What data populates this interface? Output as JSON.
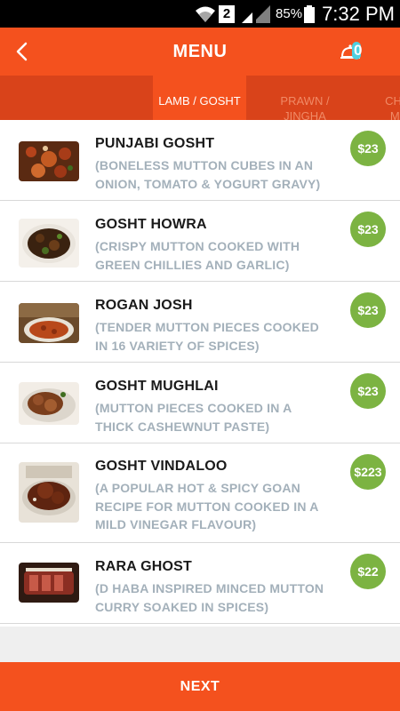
{
  "status_bar": {
    "sim_slot": "2",
    "battery": "85%",
    "time": "7:32 PM"
  },
  "header": {
    "title": "MENU",
    "cart_count": "0"
  },
  "tabs": [
    {
      "label": "LAMB / GOSHT",
      "active": true
    },
    {
      "label": "PRAWN / JINGHA",
      "active": false
    },
    {
      "label": "CHIC MU",
      "active": false
    }
  ],
  "items": [
    {
      "name": "PUNJABI GOSHT",
      "description": "(BONELESS MUTTON CUBES IN AN ONION, TOMATO & YOGURT GRAVY)",
      "price": "$23"
    },
    {
      "name": "GOSHT HOWRA",
      "description": "(CRISPY MUTTON COOKED WITH GREEN CHILLIES AND GARLIC)",
      "price": "$23"
    },
    {
      "name": "ROGAN JOSH",
      "description": "(TENDER MUTTON PIECES COOKED IN 16 VARIETY OF SPICES)",
      "price": "$23"
    },
    {
      "name": "GOSHT MUGHLAI",
      "description": "(MUTTON PIECES COOKED IN A THICK CASHEWNUT PASTE)",
      "price": "$23"
    },
    {
      "name": "GOSHT VINDALOO",
      "description": "(A POPULAR HOT & SPICY GOAN RECIPE FOR MUTTON COOKED IN A MILD VINEGAR FLAVOUR)",
      "price": "$223"
    },
    {
      "name": "RARA GHOST",
      "description": "(D HABA INSPIRED MINCED MUTTON CURRY SOAKED IN SPICES)",
      "price": "$22"
    }
  ],
  "footer": {
    "next_label": "NEXT"
  },
  "colors": {
    "primary": "#f4511e",
    "tab_bar": "#d9431a",
    "price_badge": "#7cb342",
    "description_text": "#a3b0ba"
  }
}
